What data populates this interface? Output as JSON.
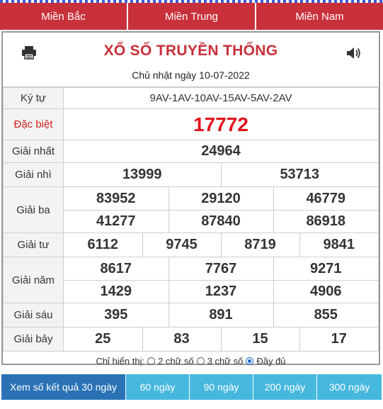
{
  "regions": [
    "Miền Bắc",
    "Miền Trung",
    "Miền Nam"
  ],
  "header": {
    "title": "XỔ SỐ TRUYỀN THỐNG",
    "date": "Chủ nhật ngày 10-07-2022"
  },
  "results": {
    "kytu": {
      "label": "Ký tự",
      "value": "9AV-1AV-10AV-15AV-5AV-2AV"
    },
    "dacbiet": {
      "label": "Đặc biệt",
      "value": "17772"
    },
    "nhat": {
      "label": "Giải nhất",
      "values": [
        "24964"
      ]
    },
    "nhi": {
      "label": "Giải nhì",
      "values": [
        "13999",
        "53713"
      ]
    },
    "ba": {
      "label": "Giải ba",
      "values": [
        "83952",
        "29120",
        "46779",
        "41277",
        "87840",
        "86918"
      ]
    },
    "tu": {
      "label": "Giải tư",
      "values": [
        "6112",
        "9745",
        "8719",
        "9841"
      ]
    },
    "nam": {
      "label": "Giải năm",
      "values": [
        "8617",
        "7767",
        "9271",
        "1429",
        "1237",
        "4906"
      ]
    },
    "sau": {
      "label": "Giải sáu",
      "values": [
        "395",
        "891",
        "855"
      ]
    },
    "bay": {
      "label": "Giải bảy",
      "values": [
        "25",
        "83",
        "15",
        "17"
      ]
    }
  },
  "options": {
    "prefix": "Chỉ hiển thị:",
    "items": [
      "2 chữ số",
      "3 chữ số",
      "Đầy đủ"
    ],
    "selected": "Đầy đủ"
  },
  "bottom_buttons": [
    "Xem số kết quả 30 ngày",
    "60 ngày",
    "90 ngày",
    "200 ngày",
    "300 ngày"
  ],
  "colors": {
    "brand_red": "#c8303a",
    "special_red": "#e1141e",
    "tab_blue": "#46b8de",
    "tab_active": "#2a72b5"
  }
}
